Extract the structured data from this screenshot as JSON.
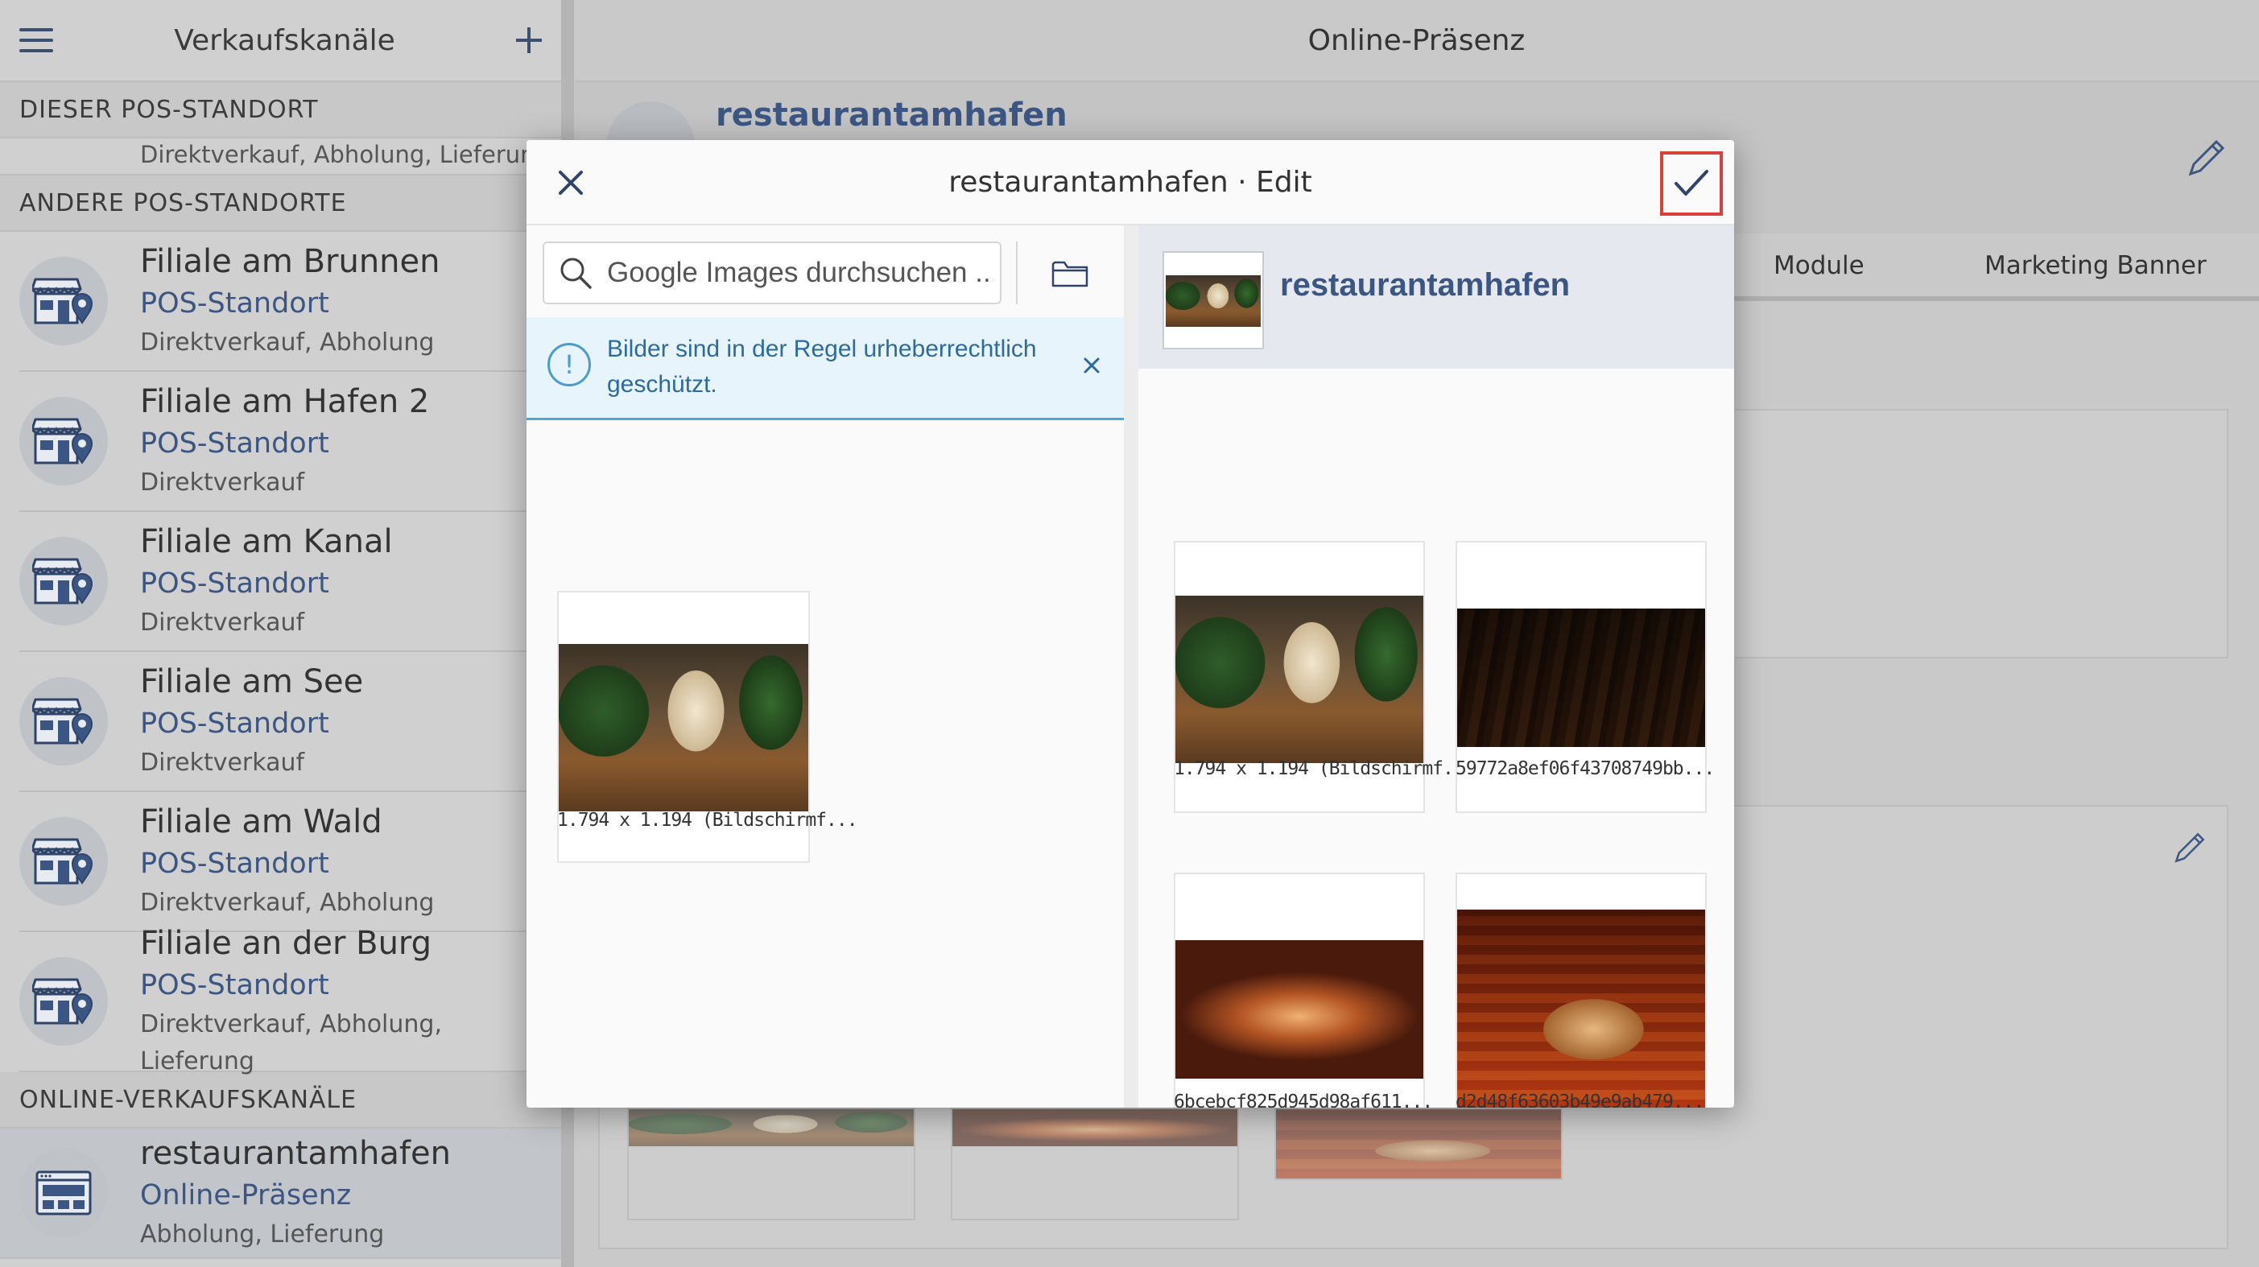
{
  "sidebar": {
    "title": "Verkaufskanäle",
    "section_this": "DIESER POS-STANDORT",
    "this_partial_sub": "Direktverkauf, Abholung, Lieferung",
    "section_other": "ANDERE POS-STANDORTE",
    "items": [
      {
        "name": "Filiale am Brunnen",
        "type": "POS-Standort",
        "sub": "Direktverkauf, Abholung"
      },
      {
        "name": "Filiale am Hafen 2",
        "type": "POS-Standort",
        "sub": "Direktverkauf"
      },
      {
        "name": "Filiale am Kanal",
        "type": "POS-Standort",
        "sub": "Direktverkauf"
      },
      {
        "name": "Filiale am See",
        "type": "POS-Standort",
        "sub": "Direktverkauf"
      },
      {
        "name": "Filiale am Wald",
        "type": "POS-Standort",
        "sub": "Direktverkauf, Abholung"
      },
      {
        "name": "Filiale an der Burg",
        "type": "POS-Standort",
        "sub": "Direktverkauf, Abholung, Lieferung"
      }
    ],
    "section_online": "ONLINE-VERKAUFSKANÄLE",
    "online_item": {
      "name": "restaurantamhafen",
      "type": "Online-Präsenz",
      "sub": "Abholung, Lieferung"
    }
  },
  "main": {
    "title": "Online-Präsenz",
    "hero_title": "restaurantamhafen",
    "tabs": [
      "Module",
      "Marketing Banner"
    ]
  },
  "modal": {
    "title": "restaurantamhafen · Edit",
    "search_placeholder": "Google Images durchsuchen ...",
    "info_text": "Bilder sind in der Regel urheberrechtlich geschützt.",
    "left_images": [
      {
        "caption": "1.794 x 1.194 (Bildschirmf..."
      }
    ],
    "right_title": "restaurantamhafen",
    "right_images": [
      {
        "caption": "1.794 x 1.194 (Bildschirmf..."
      },
      {
        "caption": "59772a8ef06f43708749bb..."
      },
      {
        "caption": "6bcebcf825d945d98af611..."
      },
      {
        "caption": "d2d48f63603b49e9ab479..."
      }
    ]
  },
  "colors": {
    "accent": "#3c5684",
    "confirm_highlight": "#d9403a",
    "info_background": "#e7f4fb",
    "info_border": "#49a7dd"
  },
  "icons": [
    "hamburger-icon",
    "plus-icon",
    "store-icon",
    "website-icon",
    "pencil-icon",
    "close-icon",
    "check-icon",
    "search-icon",
    "folder-icon",
    "info-icon"
  ]
}
